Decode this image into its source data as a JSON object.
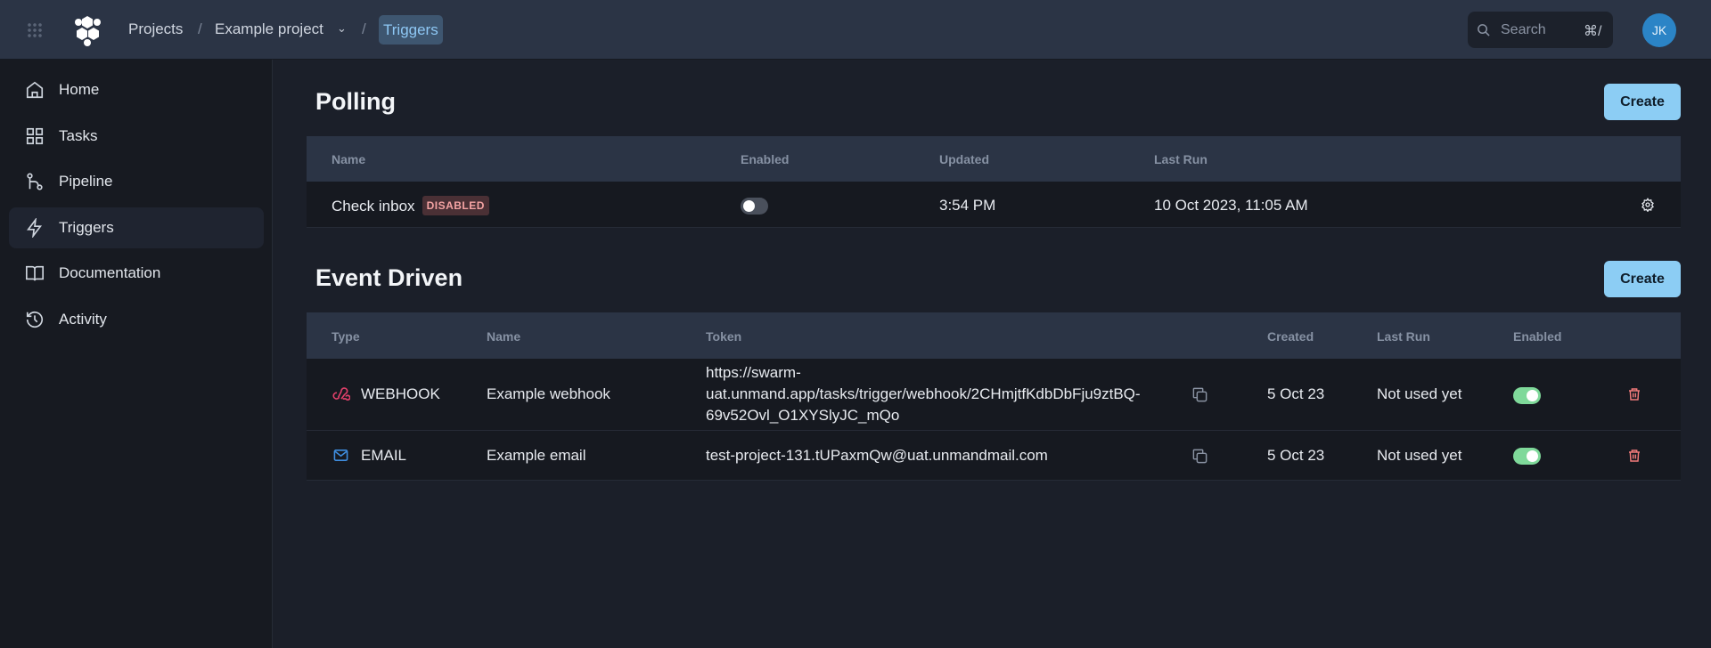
{
  "header": {
    "breadcrumbs": [
      "Projects",
      "Example project",
      "Triggers"
    ],
    "separator": "/",
    "search_placeholder": "Search",
    "search_shortcut": "⌘/",
    "avatar": "JK"
  },
  "sidebar": {
    "items": [
      {
        "label": "Home",
        "icon": "home-icon"
      },
      {
        "label": "Tasks",
        "icon": "grid-icon"
      },
      {
        "label": "Pipeline",
        "icon": "pipeline-icon"
      },
      {
        "label": "Triggers",
        "icon": "bolt-icon",
        "active": true
      },
      {
        "label": "Documentation",
        "icon": "book-icon"
      },
      {
        "label": "Activity",
        "icon": "history-icon"
      }
    ]
  },
  "polling": {
    "title": "Polling",
    "create": "Create",
    "columns": [
      "Name",
      "Enabled",
      "Updated",
      "Last Run"
    ],
    "rows": [
      {
        "name": "Check inbox",
        "badge": "DISABLED",
        "enabled": false,
        "updated": "3:54 PM",
        "last_run": "10 Oct 2023, 11:05 AM"
      }
    ]
  },
  "event": {
    "title": "Event Driven",
    "create": "Create",
    "columns": [
      "Type",
      "Name",
      "Token",
      "Created",
      "Last Run",
      "Enabled"
    ],
    "rows": [
      {
        "type": "WEBHOOK",
        "name": "Example webhook",
        "token_lines": [
          "https://swarm-",
          "uat.unmand.app/tasks/trigger/webhook/2CHmjtfKdbDbFju9ztBQ-",
          "69v52Ovl_O1XYSlyJC_mQo"
        ],
        "created": "5 Oct 23",
        "last_run": "Not used yet",
        "enabled": true
      },
      {
        "type": "EMAIL",
        "name": "Example email",
        "token": "test-project-131.tUPaxmQw@uat.unmandmail.com",
        "created": "5 Oct 23",
        "last_run": "Not used yet",
        "enabled": true
      }
    ]
  },
  "colors": {
    "accent": "#8ccdf4",
    "toggle_on": "#7fd99a",
    "danger": "#f27a7a"
  }
}
